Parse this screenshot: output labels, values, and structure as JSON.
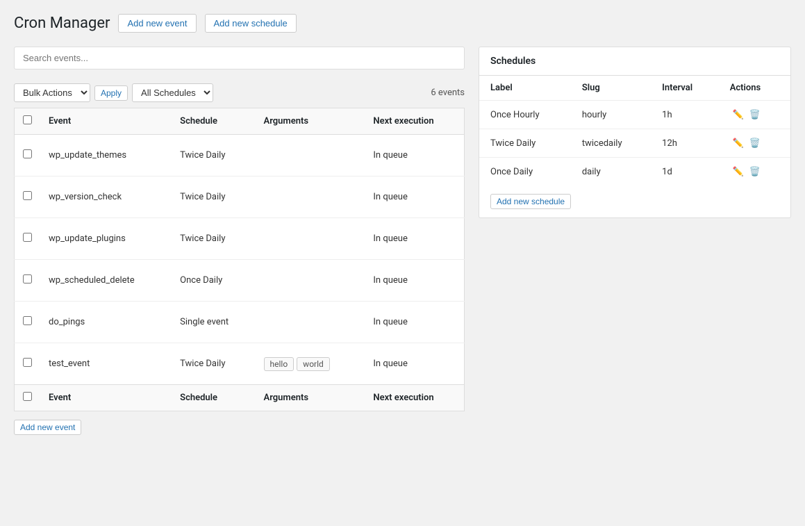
{
  "header": {
    "title": "Cron Manager",
    "add_event_label": "Add new event",
    "add_schedule_label": "Add new schedule"
  },
  "toolbar": {
    "bulk_actions_label": "Bulk Actions",
    "apply_label": "Apply",
    "all_schedules_label": "All Schedules",
    "event_count": "6 events"
  },
  "table": {
    "columns": {
      "event": "Event",
      "schedule": "Schedule",
      "arguments": "Arguments",
      "next_execution": "Next execution"
    },
    "rows": [
      {
        "id": 1,
        "event": "wp_update_themes",
        "schedule": "Twice Daily",
        "arguments": [],
        "next_execution": "In queue"
      },
      {
        "id": 2,
        "event": "wp_version_check",
        "schedule": "Twice Daily",
        "arguments": [],
        "next_execution": "In queue"
      },
      {
        "id": 3,
        "event": "wp_update_plugins",
        "schedule": "Twice Daily",
        "arguments": [],
        "next_execution": "In queue"
      },
      {
        "id": 4,
        "event": "wp_scheduled_delete",
        "schedule": "Once Daily",
        "arguments": [],
        "next_execution": "In queue"
      },
      {
        "id": 5,
        "event": "do_pings",
        "schedule": "Single event",
        "arguments": [],
        "next_execution": "In queue"
      },
      {
        "id": 6,
        "event": "test_event",
        "schedule": "Twice Daily",
        "arguments": [
          "hello",
          "world"
        ],
        "next_execution": "In queue"
      }
    ],
    "footer_columns": {
      "event": "Event",
      "schedule": "Schedule",
      "arguments": "Arguments",
      "next_execution": "Next execution"
    }
  },
  "search": {
    "placeholder": "Search events..."
  },
  "bottom_button": {
    "add_event_label": "Add new event"
  },
  "schedules": {
    "title": "Schedules",
    "columns": {
      "label": "Label",
      "slug": "Slug",
      "interval": "Interval",
      "actions": "Actions"
    },
    "rows": [
      {
        "label": "Once Hourly",
        "slug": "hourly",
        "interval": "1h"
      },
      {
        "label": "Twice Daily",
        "slug": "twicedaily",
        "interval": "12h"
      },
      {
        "label": "Once Daily",
        "slug": "daily",
        "interval": "1d"
      }
    ],
    "add_schedule_label": "Add new schedule"
  }
}
